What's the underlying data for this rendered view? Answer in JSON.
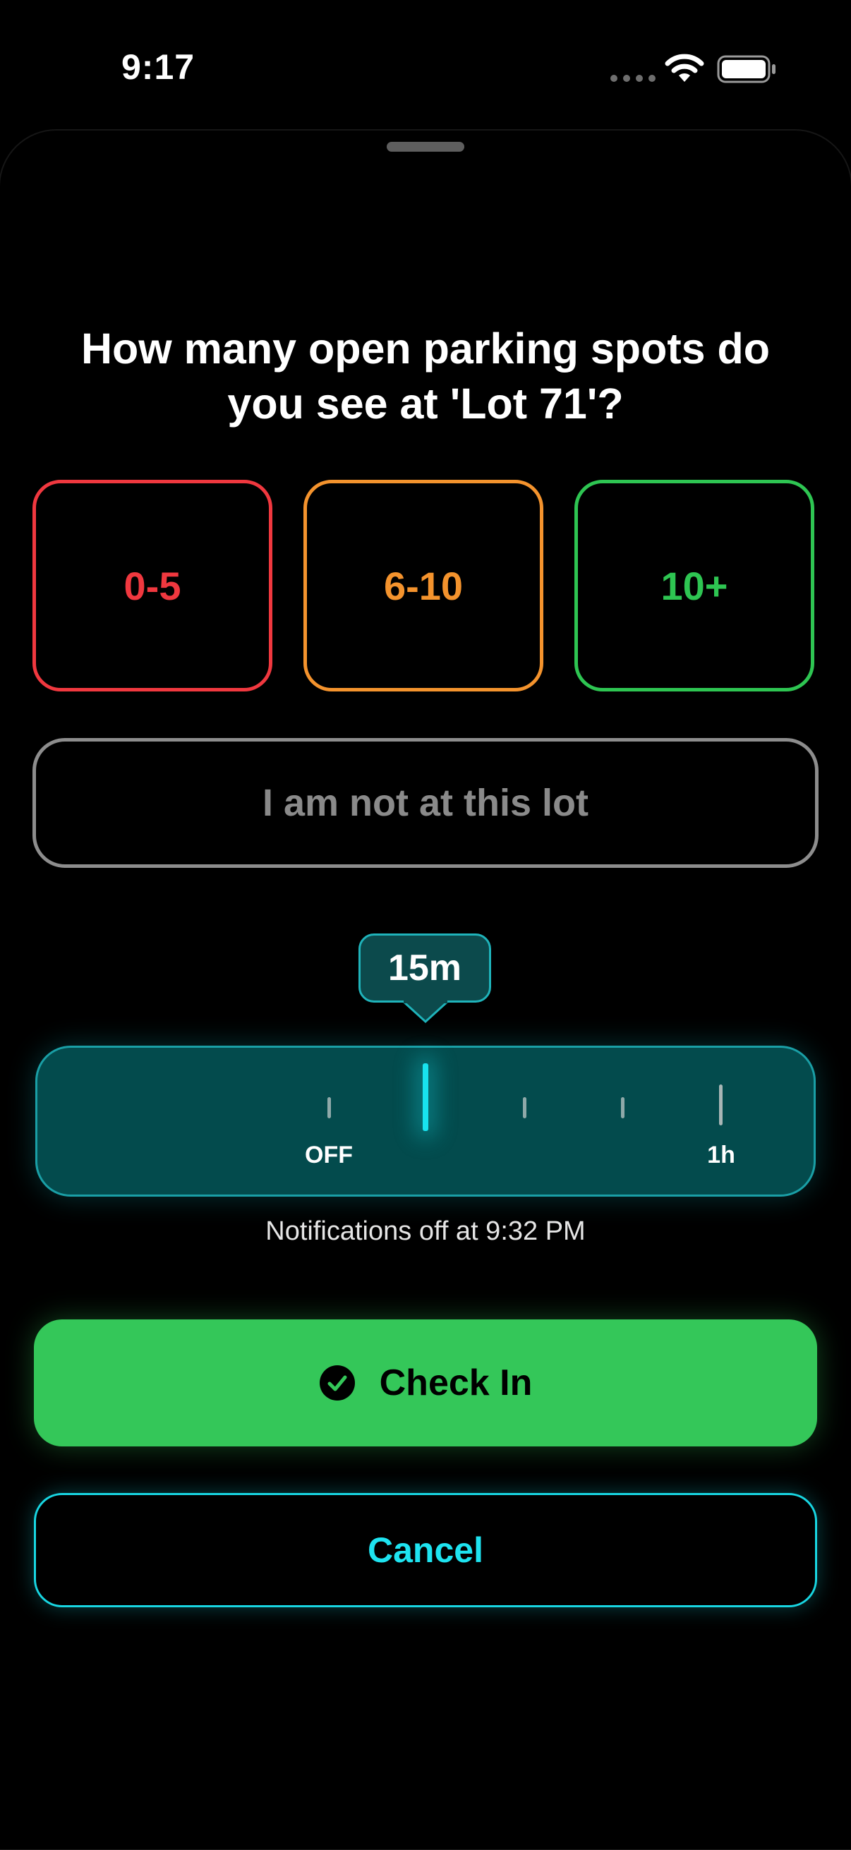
{
  "status_bar": {
    "time": "9:17",
    "icons": [
      "cellular-signal-icon",
      "wifi-icon",
      "battery-icon"
    ]
  },
  "sheet": {
    "question": "How many open parking spots do you see at 'Lot 71'?",
    "options": [
      {
        "label": "0-5",
        "color": "#f0383f"
      },
      {
        "label": "6-10",
        "color": "#f4932d"
      },
      {
        "label": "10+",
        "color": "#2ec552"
      }
    ],
    "not_at_lot_label": "I am not at this lot",
    "notification_slider": {
      "selected_value": "15m",
      "min_label": "OFF",
      "max_label": "1h",
      "selected_index": 1,
      "tick_count": 5,
      "accent_color": "#18e3ef"
    },
    "notification_text": "Notifications off at 9:32 PM",
    "check_in_label": "Check In",
    "cancel_label": "Cancel"
  },
  "colors": {
    "background": "#000000",
    "check_in_green": "#34c759",
    "cancel_cyan": "#1ee3f0"
  }
}
